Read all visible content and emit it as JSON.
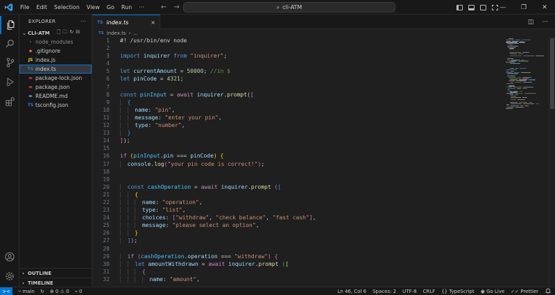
{
  "titlebar": {
    "menu": [
      "File",
      "Edit",
      "Selection",
      "View",
      "Go",
      "Run",
      "···"
    ],
    "search_text": "cli-ATM"
  },
  "sidebar": {
    "title": "EXPLORER",
    "more": "···",
    "project": "CLI-ATM",
    "files": [
      {
        "name": "node_modules",
        "icon": "›",
        "color": "#8c8c8c",
        "dim": true
      },
      {
        "name": ".gitignore",
        "icon": "◆",
        "color": "#e8664a"
      },
      {
        "name": "index.js",
        "icon": "JS",
        "color": "#e8d44d"
      },
      {
        "name": "index.ts",
        "icon": "TS",
        "color": "#3178c6",
        "selected": true
      },
      {
        "name": "package-lock.json",
        "icon": "▬",
        "color": "#cb3837"
      },
      {
        "name": "package.json",
        "icon": "▬",
        "color": "#cb3837"
      },
      {
        "name": "README.md",
        "icon": "▬",
        "color": "#519aba"
      },
      {
        "name": "tsconfig.json",
        "icon": "TS",
        "color": "#3178c6"
      }
    ],
    "outline_label": "OUTLINE",
    "timeline_label": "TIMELINE"
  },
  "tab": {
    "badge": "TS",
    "label": "index.ts",
    "close": "×"
  },
  "breadcrumb": {
    "file": "index.ts",
    "sep": "›",
    "more": "..."
  },
  "code": [
    {
      "n": "1",
      "t": [
        [
          "#! /usr/bin/env node",
          "#cccccc"
        ]
      ]
    },
    {
      "n": "2",
      "t": []
    },
    {
      "n": "3",
      "t": [
        [
          "import ",
          "#569cd6"
        ],
        [
          "inquirer ",
          "#9cdcfe"
        ],
        [
          "from ",
          "#569cd6"
        ],
        [
          "\"inquirer\"",
          "#ce9178"
        ],
        [
          ";",
          "#cccccc"
        ]
      ]
    },
    {
      "n": "4",
      "t": []
    },
    {
      "n": "5",
      "t": [
        [
          "let ",
          "#569cd6"
        ],
        [
          "currentAmount",
          "#9cdcfe"
        ],
        [
          " = ",
          "#cccccc"
        ],
        [
          "50000",
          "#b5cea8"
        ],
        [
          "; ",
          "#cccccc"
        ],
        [
          "//in $",
          "#6a9955"
        ]
      ]
    },
    {
      "n": "6",
      "t": [
        [
          "let ",
          "#569cd6"
        ],
        [
          "pinCode",
          "#9cdcfe"
        ],
        [
          " = ",
          "#cccccc"
        ],
        [
          "4321",
          "#b5cea8"
        ],
        [
          ";",
          "#cccccc"
        ]
      ]
    },
    {
      "n": "7",
      "t": []
    },
    {
      "n": "8",
      "t": [
        [
          "const ",
          "#569cd6"
        ],
        [
          "pinInput",
          "#4fc1ff"
        ],
        [
          " = ",
          "#cccccc"
        ],
        [
          "await ",
          "#c586c0"
        ],
        [
          "inquirer",
          "#9cdcfe"
        ],
        [
          ".",
          "#cccccc"
        ],
        [
          "prompt",
          "#dcdcaa"
        ],
        [
          "(",
          "#cccccc"
        ],
        [
          "[",
          "#da70d6"
        ]
      ]
    },
    {
      "n": "9",
      "i": 1,
      "t": [
        [
          "{",
          "#179fff"
        ]
      ]
    },
    {
      "n": "10",
      "i": 2,
      "t": [
        [
          "name",
          "#9cdcfe"
        ],
        [
          ": ",
          "#cccccc"
        ],
        [
          "\"pin\"",
          "#ce9178"
        ],
        [
          ",",
          "#cccccc"
        ]
      ]
    },
    {
      "n": "11",
      "i": 2,
      "t": [
        [
          "message",
          "#9cdcfe"
        ],
        [
          ": ",
          "#cccccc"
        ],
        [
          "\"enter your pin\"",
          "#ce9178"
        ],
        [
          ",",
          "#cccccc"
        ]
      ]
    },
    {
      "n": "12",
      "i": 2,
      "t": [
        [
          "type",
          "#9cdcfe"
        ],
        [
          ": ",
          "#cccccc"
        ],
        [
          "\"number\"",
          "#ce9178"
        ],
        [
          ",",
          "#cccccc"
        ]
      ]
    },
    {
      "n": "13",
      "i": 1,
      "t": [
        [
          "}",
          "#179fff"
        ]
      ]
    },
    {
      "n": "14",
      "t": [
        [
          "]",
          "#da70d6"
        ],
        [
          ");",
          "#cccccc"
        ]
      ]
    },
    {
      "n": "15",
      "t": []
    },
    {
      "n": "16",
      "t": [
        [
          "if ",
          "#c586c0"
        ],
        [
          "(",
          "#ffd700"
        ],
        [
          "pinInput",
          "#4fc1ff"
        ],
        [
          ".",
          "#cccccc"
        ],
        [
          "pin",
          "#9cdcfe"
        ],
        [
          " === ",
          "#cccccc"
        ],
        [
          "pinCode",
          "#9cdcfe"
        ],
        [
          ") ",
          "#ffd700"
        ],
        [
          "{",
          "#ffd700"
        ]
      ]
    },
    {
      "n": "17",
      "i": 1,
      "t": [
        [
          "console",
          "#9cdcfe"
        ],
        [
          ".",
          "#cccccc"
        ],
        [
          "log",
          "#dcdcaa"
        ],
        [
          "(",
          "#da70d6"
        ],
        [
          "\"your pin code is correct!\"",
          "#ce9178"
        ],
        [
          ")",
          "#da70d6"
        ],
        [
          ";",
          "#cccccc"
        ]
      ]
    },
    {
      "n": "18",
      "t": []
    },
    {
      "n": "19",
      "t": []
    },
    {
      "n": "20",
      "i": 1,
      "t": [
        [
          "const ",
          "#569cd6"
        ],
        [
          "cashOperation",
          "#4fc1ff"
        ],
        [
          " = ",
          "#cccccc"
        ],
        [
          "await ",
          "#c586c0"
        ],
        [
          "inquirer",
          "#9cdcfe"
        ],
        [
          ".",
          "#cccccc"
        ],
        [
          "prompt ",
          "#dcdcaa"
        ],
        [
          "(",
          "#da70d6"
        ],
        [
          "[",
          "#179fff"
        ]
      ]
    },
    {
      "n": "21",
      "i": 2,
      "t": [
        [
          "{",
          "#ffd700"
        ]
      ]
    },
    {
      "n": "22",
      "i": 3,
      "t": [
        [
          "name",
          "#9cdcfe"
        ],
        [
          ": ",
          "#cccccc"
        ],
        [
          "\"operation\"",
          "#ce9178"
        ],
        [
          ",",
          "#cccccc"
        ]
      ]
    },
    {
      "n": "23",
      "i": 3,
      "t": [
        [
          "type",
          "#9cdcfe"
        ],
        [
          ": ",
          "#cccccc"
        ],
        [
          "\"list\"",
          "#ce9178"
        ],
        [
          ",",
          "#cccccc"
        ]
      ]
    },
    {
      "n": "24",
      "i": 3,
      "t": [
        [
          "choices",
          "#9cdcfe"
        ],
        [
          ": ",
          "#cccccc"
        ],
        [
          "[",
          "#da70d6"
        ],
        [
          "\"withdraw\"",
          "#ce9178"
        ],
        [
          ", ",
          "#cccccc"
        ],
        [
          "\"check balance\"",
          "#ce9178"
        ],
        [
          ", ",
          "#cccccc"
        ],
        [
          "\"fast cash\"",
          "#ce9178"
        ],
        [
          "]",
          "#da70d6"
        ],
        [
          ",",
          "#cccccc"
        ]
      ]
    },
    {
      "n": "25",
      "i": 3,
      "t": [
        [
          "message",
          "#9cdcfe"
        ],
        [
          ": ",
          "#cccccc"
        ],
        [
          "\"please select an option\"",
          "#ce9178"
        ],
        [
          ",",
          "#cccccc"
        ]
      ]
    },
    {
      "n": "26",
      "i": 2,
      "t": [
        [
          "}",
          "#ffd700"
        ]
      ]
    },
    {
      "n": "27",
      "i": 1,
      "t": [
        [
          "]",
          "#179fff"
        ],
        [
          ")",
          "#da70d6"
        ],
        [
          ";",
          "#cccccc"
        ]
      ]
    },
    {
      "n": "28",
      "t": []
    },
    {
      "n": "29",
      "i": 1,
      "t": [
        [
          "if ",
          "#c586c0"
        ],
        [
          "(",
          "#da70d6"
        ],
        [
          "cashOperation",
          "#4fc1ff"
        ],
        [
          ".",
          "#cccccc"
        ],
        [
          "operation",
          "#9cdcfe"
        ],
        [
          " === ",
          "#cccccc"
        ],
        [
          "\"withdraw\"",
          "#ce9178"
        ],
        [
          ") ",
          "#da70d6"
        ],
        [
          "{",
          "#da70d6"
        ]
      ]
    },
    {
      "n": "30",
      "i": 2,
      "t": [
        [
          "let ",
          "#569cd6"
        ],
        [
          "amountWithdrawn",
          "#9cdcfe"
        ],
        [
          " = ",
          "#cccccc"
        ],
        [
          "await ",
          "#c586c0"
        ],
        [
          "inquirer",
          "#9cdcfe"
        ],
        [
          ".",
          "#cccccc"
        ],
        [
          "prompt ",
          "#dcdcaa"
        ],
        [
          "(",
          "#179fff"
        ],
        [
          "[",
          "#ffd700"
        ]
      ]
    },
    {
      "n": "31",
      "i": 3,
      "t": [
        [
          "{",
          "#da70d6"
        ]
      ]
    },
    {
      "n": "32",
      "i": 4,
      "t": [
        [
          "name",
          "#9cdcfe"
        ],
        [
          ": ",
          "#cccccc"
        ],
        [
          "\"amount\"",
          "#ce9178"
        ],
        [
          ",",
          "#cccccc"
        ]
      ]
    }
  ],
  "statusbar": {
    "remote": "><",
    "branch": "main",
    "sync": "↻",
    "problems": "⊗ 0 ⚠ 0",
    "ports": "⌁ 0",
    "position": "Ln 46, Col 6",
    "spaces": "Spaces: 2",
    "encoding": "UTF-8",
    "eol": "CRLF",
    "language": "{} TypeScript",
    "golive": "◉ Go Live",
    "prettier": "✓✓ Prettier",
    "bell": "🔔"
  },
  "colors": {
    "accent": "#0078d4",
    "background": "#1f1f1f",
    "chrome": "#181818"
  }
}
